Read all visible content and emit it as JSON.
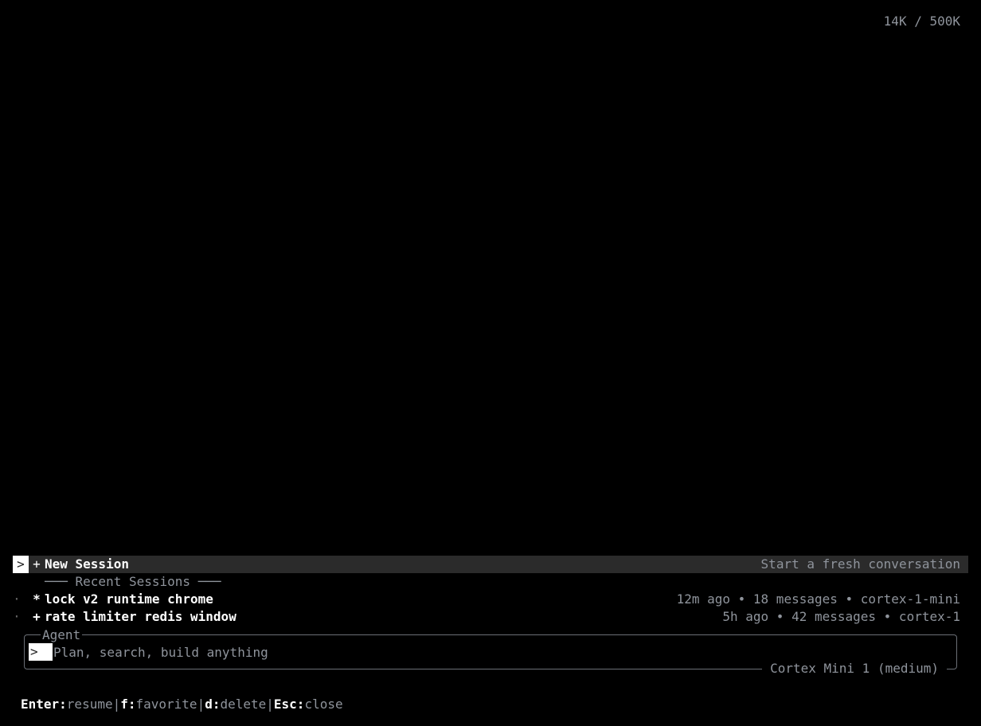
{
  "token_counter": "14K / 500K",
  "new_session": {
    "cursor": ">",
    "mark": "+",
    "label": "New Session",
    "description": "Start a fresh conversation"
  },
  "recent_header": "─── Recent Sessions ───",
  "sessions": [
    {
      "dot": "·",
      "mark": "*",
      "title": "lock v2 runtime chrome",
      "meta": "12m ago • 18 messages • cortex-1-mini"
    },
    {
      "dot": "·",
      "mark": "+",
      "title": "rate limiter redis window",
      "meta": "5h ago • 42 messages • cortex-1"
    }
  ],
  "agent": {
    "label": "Agent",
    "prompt": ">",
    "value": "",
    "placeholder": "Plan, search, build anything",
    "model": "Cortex Mini 1 (medium)"
  },
  "shortcuts": [
    {
      "key": "Enter:",
      "action": "resume"
    },
    {
      "key": "f:",
      "action": "favorite"
    },
    {
      "key": "d:",
      "action": "delete"
    },
    {
      "key": "Esc:",
      "action": "close"
    }
  ],
  "shortcut_separator": "|"
}
